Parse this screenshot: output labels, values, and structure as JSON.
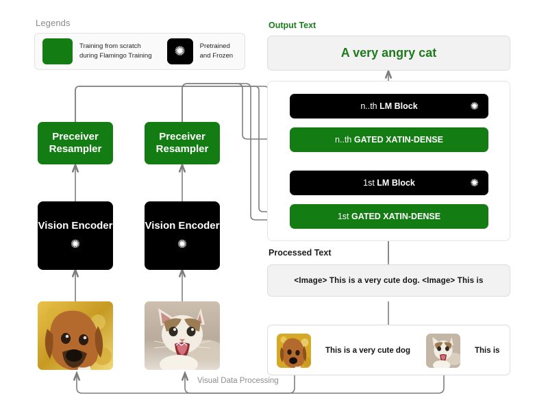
{
  "legend": {
    "title": "Legends",
    "items": [
      {
        "swatch": "green-swatch",
        "label": "Training from scratch\nduring Flamingo Training"
      },
      {
        "swatch": "black-snowflake-swatch",
        "icon": "snowflake-icon",
        "label": "Pretrained\nand Frozen"
      }
    ]
  },
  "output": {
    "caption": "Output Text",
    "text": "A very angry cat"
  },
  "lm_stack": {
    "blocks": [
      {
        "name": "nth-lm-block",
        "prefix": "n..th ",
        "label": "LM Block",
        "kind": "black",
        "icon": "snowflake-icon"
      },
      {
        "name": "nth-gated-xattn",
        "prefix": "n..th ",
        "label": "GATED XATIN-DENSE",
        "kind": "green"
      },
      {
        "name": "first-lm-block",
        "prefix": "1st ",
        "label": "LM Block",
        "kind": "black",
        "icon": "snowflake-icon"
      },
      {
        "name": "first-gated-xattn",
        "prefix": "1st ",
        "label": "GATED XATIN-DENSE",
        "kind": "green"
      }
    ]
  },
  "processed": {
    "caption": "Processed Text",
    "text": "<Image> This  is a very cute dog.   <Image> This  is"
  },
  "input_row": {
    "items": [
      {
        "image": "dog-photo",
        "text": "This is a very cute dog"
      },
      {
        "image": "cat-photo",
        "text": "This is"
      }
    ]
  },
  "vision_pipeline": {
    "columns": [
      {
        "resampler": "Preceiver Resampler",
        "encoder": "Vision Encoder",
        "encoder_icon": "snowflake-icon",
        "image": "dog-photo"
      },
      {
        "resampler": "Preceiver Resampler",
        "encoder": "Vision Encoder",
        "encoder_icon": "snowflake-icon",
        "image": "cat-photo"
      }
    ]
  },
  "connectors": {
    "visual_data_processing_label": "Visual Data Processing"
  },
  "colors": {
    "green": "#137C13",
    "black": "#000000",
    "wire": "#7d7d7d",
    "panel_grey": "#f2f2f2",
    "caption_grey": "#8a8a8a",
    "output_green": "#1d7a1d"
  }
}
